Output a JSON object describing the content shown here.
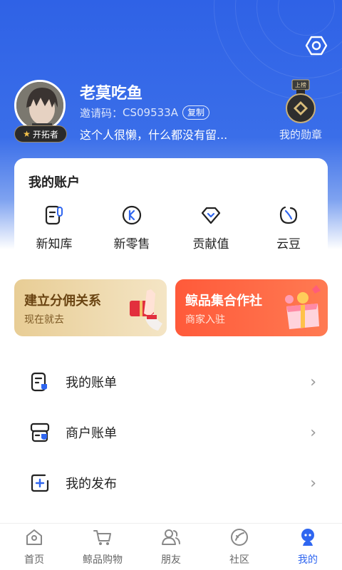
{
  "profile": {
    "username": "老莫吃鱼",
    "invite_label": "邀请码：",
    "invite_code": "CS09533A",
    "copy_label": "复制",
    "bio": "这个人很懒，什么都没有留...",
    "badge_label": "开拓者",
    "medal_tag": "上榜",
    "medal_label": "我的勋章"
  },
  "account": {
    "title": "我的账户",
    "items": [
      {
        "label": "新知库",
        "icon": "knowledge-icon"
      },
      {
        "label": "新零售",
        "icon": "retail-icon"
      },
      {
        "label": "贡献值",
        "icon": "contribution-icon"
      },
      {
        "label": "云豆",
        "icon": "cloud-bean-icon"
      }
    ]
  },
  "banners": [
    {
      "title": "建立分佣关系",
      "subtitle": "现在就去"
    },
    {
      "title": "鲸品集合作社",
      "subtitle": "商家入驻"
    }
  ],
  "menu": [
    {
      "label": "我的账单",
      "icon": "bill-icon"
    },
    {
      "label": "商户账单",
      "icon": "merchant-bill-icon"
    },
    {
      "label": "我的发布",
      "icon": "publish-icon"
    }
  ],
  "tabs": [
    {
      "label": "首页",
      "icon": "home-icon"
    },
    {
      "label": "鲸品购物",
      "icon": "cart-icon"
    },
    {
      "label": "朋友",
      "icon": "friends-icon"
    },
    {
      "label": "社区",
      "icon": "community-icon"
    },
    {
      "label": "我的",
      "icon": "me-icon",
      "active": true
    }
  ],
  "colors": {
    "primary": "#2f66f0",
    "hero_top": "#2f62e6",
    "banner_left": "#e8cd95",
    "banner_right": "#ff5a3a"
  }
}
